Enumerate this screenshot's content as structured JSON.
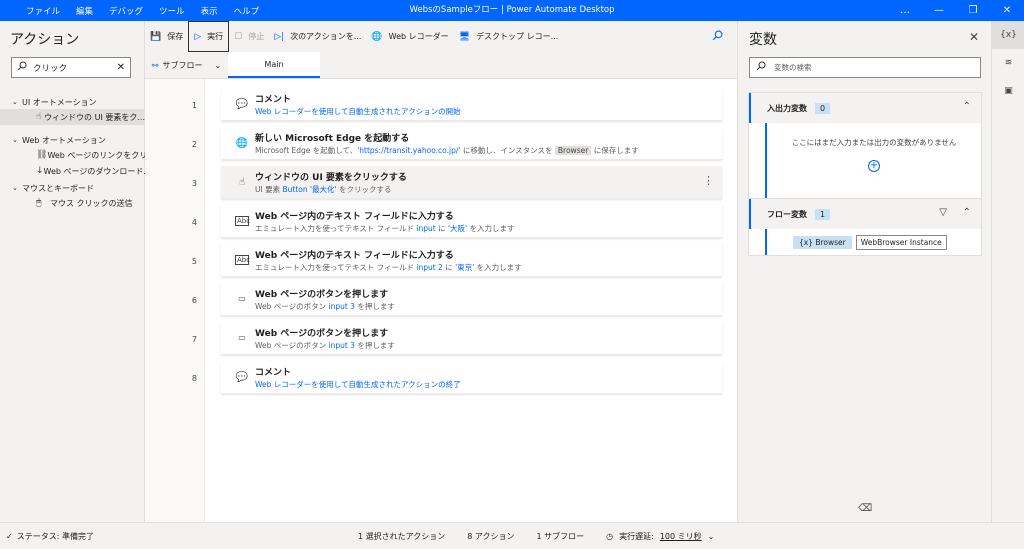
{
  "titlebar": {
    "menu": [
      "ファイル",
      "編集",
      "デバッグ",
      "ツール",
      "表示",
      "ヘルプ"
    ],
    "title": "WebsのSampleフロー | Power Automate Desktop",
    "controls": [
      "…",
      "—",
      "❐",
      "✕"
    ]
  },
  "actions_panel": {
    "title": "アクション",
    "search_value": "クリック",
    "groups": [
      {
        "label": "UI オートメーション",
        "items": [
          {
            "label": "ウィンドウの UI 要素をク...",
            "icon": "click-icon"
          }
        ]
      },
      {
        "label": "Web オートメーション",
        "items": [
          {
            "label": "Web ページのリンクをクリ...",
            "icon": "link-icon"
          },
          {
            "label": "Web ページのダウンロード...",
            "icon": "download-icon"
          }
        ]
      },
      {
        "label": "マウスとキーボード",
        "items": [
          {
            "label": "マウス クリックの送信",
            "icon": "mouse-icon"
          }
        ]
      }
    ]
  },
  "toolbar": {
    "save": "保存",
    "run": "実行",
    "stop": "停止",
    "next": "次のアクションを...",
    "web_recorder": "Web レコーダー",
    "desktop_recorder": "デスクトップ レコー..."
  },
  "subbar": {
    "subflow": "サブフロー",
    "tab_main": "Main"
  },
  "flow": {
    "steps": [
      {
        "num": "1",
        "title": "コメント",
        "icon": "comment-icon",
        "parts": [
          {
            "t": "Web レコーダーを使用して自動生成されたアクションの開始",
            "c": "hl"
          }
        ]
      },
      {
        "num": "2",
        "title": "新しい Microsoft Edge を起動する",
        "icon": "globe-icon",
        "parts": [
          {
            "t": "Microsoft Edge を起動して、",
            "c": ""
          },
          {
            "t": "'https://transit.yahoo.co.jp/'",
            "c": "hl"
          },
          {
            "t": " に移動し、インスタンスを ",
            "c": ""
          },
          {
            "t": "Browser",
            "c": "chip"
          },
          {
            "t": " に保存します",
            "c": ""
          }
        ]
      },
      {
        "num": "3",
        "title": "ウィンドウの UI 要素をクリックする",
        "icon": "click-icon",
        "selected": true,
        "parts": [
          {
            "t": "UI 要素 ",
            "c": ""
          },
          {
            "t": "Button '最大化'",
            "c": "hl"
          },
          {
            "t": " をクリックする",
            "c": ""
          }
        ]
      },
      {
        "num": "4",
        "title": "Web ページ内のテキスト フィールドに入力する",
        "icon": "textfield-icon",
        "parts": [
          {
            "t": "エミュレート入力を使ってテキスト フィールド ",
            "c": ""
          },
          {
            "t": "input",
            "c": "hl"
          },
          {
            "t": " に ",
            "c": ""
          },
          {
            "t": "'大阪'",
            "c": "hl"
          },
          {
            "t": " を入力します",
            "c": ""
          }
        ]
      },
      {
        "num": "5",
        "title": "Web ページ内のテキスト フィールドに入力する",
        "icon": "textfield-icon",
        "parts": [
          {
            "t": "エミュレート入力を使ってテキスト フィールド ",
            "c": ""
          },
          {
            "t": "input 2",
            "c": "hl"
          },
          {
            "t": " に ",
            "c": ""
          },
          {
            "t": "'東京'",
            "c": "hl"
          },
          {
            "t": " を入力します",
            "c": ""
          }
        ]
      },
      {
        "num": "6",
        "title": "Web ページのボタンを押します",
        "icon": "button-icon",
        "parts": [
          {
            "t": "Web ページのボタン ",
            "c": ""
          },
          {
            "t": "input 3",
            "c": "hl"
          },
          {
            "t": " を押します",
            "c": ""
          }
        ]
      },
      {
        "num": "7",
        "title": "Web ページのボタンを押します",
        "icon": "button-icon",
        "parts": [
          {
            "t": "Web ページのボタン ",
            "c": ""
          },
          {
            "t": "input 3",
            "c": "hl"
          },
          {
            "t": " を押します",
            "c": ""
          }
        ]
      },
      {
        "num": "8",
        "title": "コメント",
        "icon": "comment-icon",
        "parts": [
          {
            "t": "Web レコーダーを使用して自動生成されたアクションの終了",
            "c": "hl"
          }
        ]
      }
    ]
  },
  "variables_panel": {
    "title": "変数",
    "search_placeholder": "変数の検索",
    "io_section": {
      "label": "入出力変数",
      "count": "0",
      "empty_text": "ここにはまだ入力または出力の変数がありません"
    },
    "flow_section": {
      "label": "フロー変数",
      "count": "1",
      "var_name": "{x} Browser",
      "var_tooltip": "WebBrowser Instance"
    }
  },
  "status": {
    "state": "ステータス: 準備完了",
    "selected": "1 選択されたアクション",
    "actions": "8 アクション",
    "subflows": "1 サブフロー",
    "delay_label": "実行遅延:",
    "delay_value": "100 ミリ秒"
  },
  "colors": {
    "accent": "#0066ff",
    "badge": "#c7e0f4"
  }
}
